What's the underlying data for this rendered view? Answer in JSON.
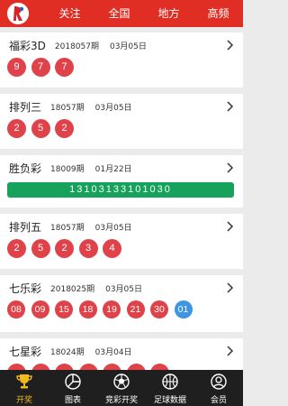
{
  "header": {
    "tabs": [
      "关注",
      "全国",
      "地方",
      "高频"
    ]
  },
  "lotteries": [
    {
      "name": "福彩3D",
      "issue": "2018057期",
      "date": "03月05日",
      "balls": [
        "9",
        "7",
        "7"
      ]
    },
    {
      "name": "排列三",
      "issue": "18057期",
      "date": "03月05日",
      "balls": [
        "2",
        "5",
        "2"
      ]
    },
    {
      "name": "胜负彩",
      "issue": "18009期",
      "date": "01月22日",
      "result": "13103133101030"
    },
    {
      "name": "排列五",
      "issue": "18057期",
      "date": "03月05日",
      "balls": [
        "2",
        "5",
        "2",
        "3",
        "4"
      ]
    },
    {
      "name": "七乐彩",
      "issue": "2018025期",
      "date": "03月05日",
      "balls": [
        "08",
        "09",
        "15",
        "18",
        "19",
        "21",
        "30"
      ],
      "special": "01"
    },
    {
      "name": "七星彩",
      "issue": "18024期",
      "date": "03月04日"
    }
  ],
  "bottom_nav": {
    "items": [
      {
        "label": "开奖",
        "icon": "trophy-icon",
        "active": true
      },
      {
        "label": "图表",
        "icon": "chart-icon",
        "active": false
      },
      {
        "label": "竞彩开奖",
        "icon": "soccer-icon",
        "active": false
      },
      {
        "label": "足球数据",
        "icon": "basketball-icon",
        "active": false
      },
      {
        "label": "会员",
        "icon": "user-icon",
        "active": false
      }
    ]
  },
  "colors": {
    "header_red": "#e02e24",
    "ball_red": "#e0424a",
    "ball_blue": "#3d95e3",
    "result_green": "#16a25a",
    "nav_bg": "#1f1f1f",
    "nav_active": "#f2b81e"
  }
}
